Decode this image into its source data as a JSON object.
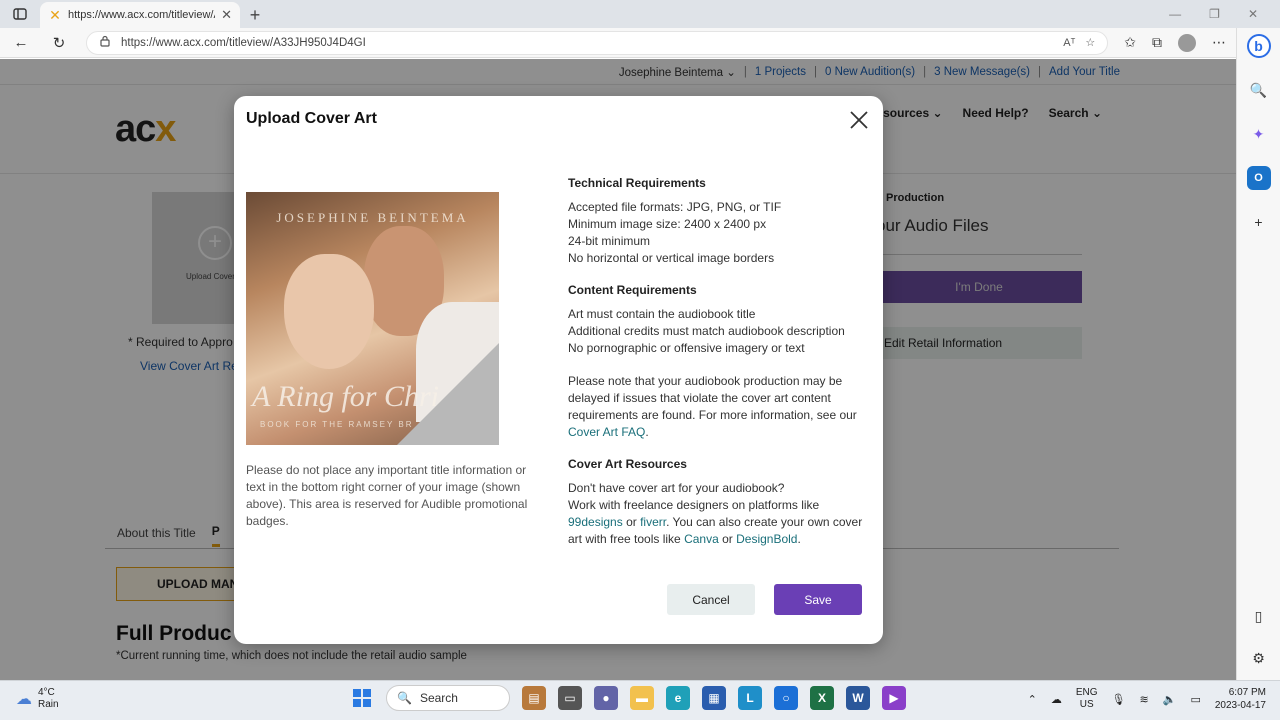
{
  "browser": {
    "tab_title": "https://www.acx.com/titleview/A",
    "url": "https://www.acx.com/titleview/A33JH950J4D4GI",
    "new_tab": "+",
    "read_aloud": "Aᵀ"
  },
  "site": {
    "topnav": {
      "user": "Josephine Beintema",
      "projects": "1 Projects",
      "auditions": "0 New Audition(s)",
      "messages": "3 New Message(s)",
      "add_title": "Add Your Title",
      "separator": "|"
    },
    "logo": {
      "main": "ac",
      "accent": "x"
    },
    "main_nav": [
      "esources",
      "Need Help?",
      "Search"
    ],
    "upload_cover_label": "Upload Cover",
    "required_text": "* Required to Appro",
    "view_requirements": "View Cover Art Re",
    "production_label": "Production",
    "audio_files_title": "our Audio Files",
    "done_button": "I'm Done",
    "edit_retail": "Edit Retail Information",
    "tabs": [
      "About this Title",
      "P"
    ],
    "upload_manual": "UPLOAD MAN",
    "full_production": "Full Produc",
    "running_time": "*Current running time, which does not include the retail audio sample"
  },
  "modal": {
    "title": "Upload Cover Art",
    "cover": {
      "author": "JOSEPHINE BEINTEMA",
      "book_title": "A Ring for Chri",
      "subtitle": "BOOK FOR THE RAMSEY BR"
    },
    "cover_note": "Please do not place any important title information or text in the bottom right corner of your image (shown above). This area is reserved for Audible promotional badges.",
    "technical": {
      "heading": "Technical Requirements",
      "lines": [
        "Accepted file formats: JPG, PNG, or TIF",
        "Minimum image size: 2400 x 2400 px",
        "24-bit minimum",
        "No horizontal or vertical image borders"
      ]
    },
    "content": {
      "heading": "Content Requirements",
      "lines": [
        "Art must contain the audiobook title",
        "Additional credits must match audiobook description",
        "No pornographic or offensive imagery or text"
      ]
    },
    "note": {
      "text": "Please note that your audiobook production may be delayed if issues that violate the cover art content requirements are found. For more information, see our",
      "link": "Cover Art FAQ",
      "end": "."
    },
    "resources": {
      "heading": "Cover Art Resources",
      "line1": "Don't have cover art for your audiobook?",
      "line2": "Work with freelance designers on platforms like",
      "link_99designs": "99designs",
      "or1": "or",
      "link_fiverr": "fiverr",
      "mid": ". You can also create your own cover art with free tools like",
      "link_canva": "Canva",
      "or2": "or",
      "link_designbold": "DesignBold",
      "end": "."
    },
    "cancel_label": "Cancel",
    "save_label": "Save"
  },
  "taskbar": {
    "weather_temp": "4°C",
    "weather_desc": "Rain",
    "search_label": "Search",
    "lang_top": "ENG",
    "lang_bottom": "US",
    "time": "6:07 PM",
    "date": "2023-04-17"
  }
}
